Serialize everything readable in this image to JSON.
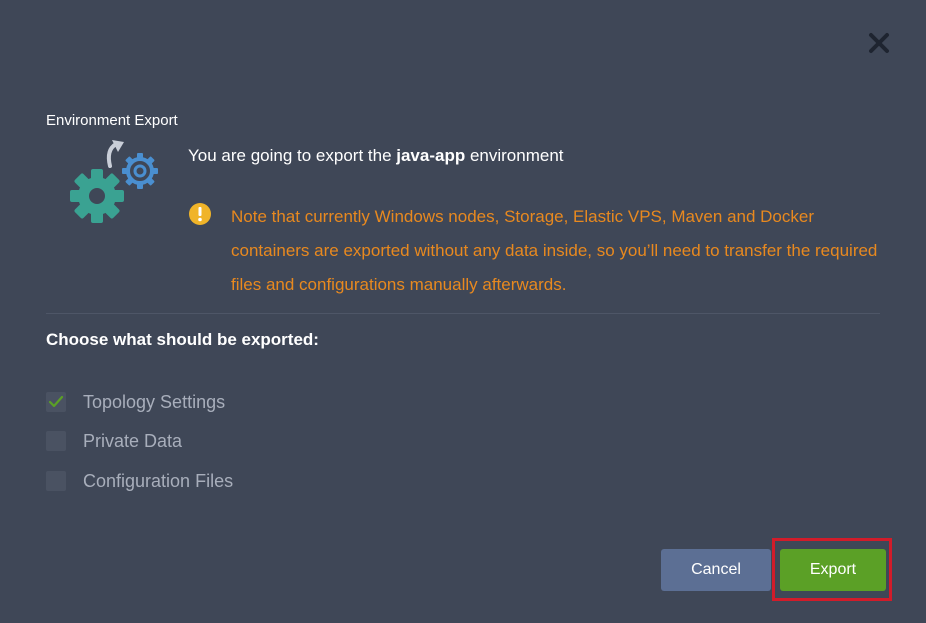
{
  "dialog": {
    "title": "Environment Export",
    "close_icon": "close-icon",
    "headline": {
      "prefix": "You are going to export the ",
      "env_name": "java-app",
      "suffix": " environment"
    },
    "warning": {
      "icon": "warning-icon",
      "text": "Note that currently Windows nodes, Storage, Elastic VPS, Maven and Docker containers are exported without any data inside, so you’ll need to transfer the required files and configurations manually afterwards."
    },
    "section_title": "Choose what should be exported:",
    "options": [
      {
        "label": "Topology Settings",
        "checked": true
      },
      {
        "label": "Private Data",
        "checked": false
      },
      {
        "label": "Configuration Files",
        "checked": false
      }
    ],
    "buttons": {
      "cancel_label": "Cancel",
      "export_label": "Export"
    }
  },
  "colors": {
    "background": "#3f4757",
    "warning": "#e8891f",
    "export_button": "#5ba026",
    "cancel_button": "#5c6f94",
    "highlight": "#d21c2a",
    "gear_large": "#3aa292",
    "gear_small": "#4a8fd0"
  }
}
